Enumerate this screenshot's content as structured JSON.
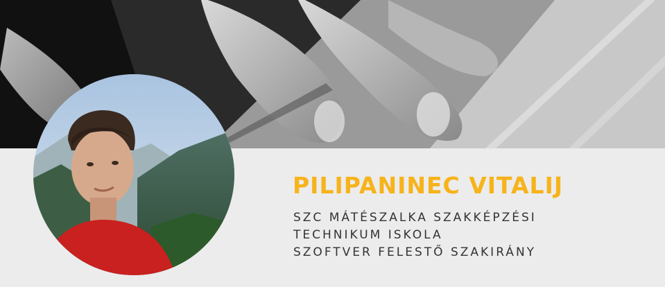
{
  "profile": {
    "name": "PILIPANINEC VITALIJ",
    "info_lines": [
      "SZC MÁTÉSZALKA SZAKKÉPZÉSI",
      "TECHNIKUM ISKOLA",
      "SZOFTVER FELESTŐ SZAKIRÁNY"
    ]
  },
  "colors": {
    "accent": "#f7b31b",
    "text": "#333333",
    "background": "#ececec"
  }
}
